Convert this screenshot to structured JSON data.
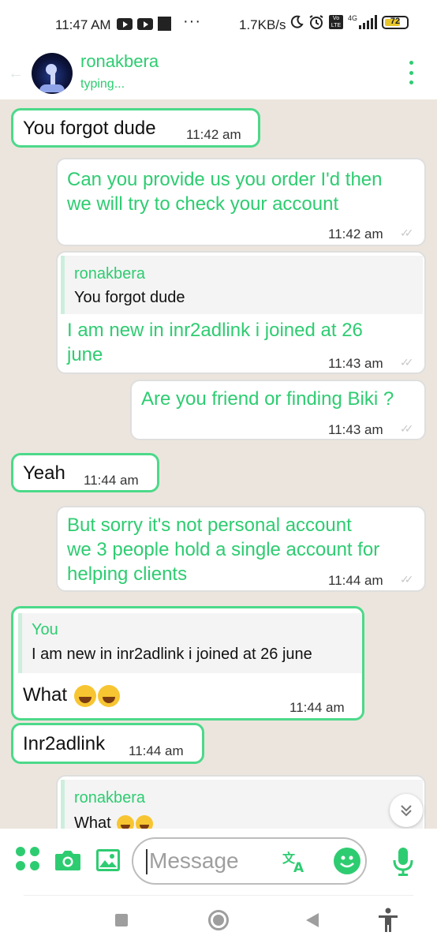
{
  "status_bar": {
    "time": "11:47 AM",
    "dots": "···",
    "network_speed": "1.7KB/s",
    "network_type": "4G",
    "volte": "Vo LTE",
    "battery": "72",
    "battery_level": 0.72,
    "icons": [
      "youtube-icon",
      "youtube-icon",
      "app-icon",
      "moon-icon",
      "alarm-icon",
      "volte-icon",
      "signal-icon",
      "battery-icon"
    ]
  },
  "header": {
    "contact_name": "ronakbera",
    "contact_status": "typing...",
    "icons": [
      "back-arrow-icon",
      "avatar",
      "more-vert-icon"
    ]
  },
  "messages": [
    {
      "direction": "in",
      "text": "You forgot dude",
      "time": "11:42 am"
    },
    {
      "direction": "out",
      "text_lines": [
        "Can you provide us you order I'd then",
        "we will try to check your account"
      ],
      "time": "11:42 am"
    },
    {
      "direction": "out",
      "quote": {
        "name": "ronakbera",
        "text": "You forgot dude"
      },
      "text_lines": [
        "I am new in inr2adlink i joined at 26",
        "june"
      ],
      "time": "11:43 am"
    },
    {
      "direction": "out",
      "text": "Are you friend or finding Biki ?",
      "time": "11:43 am"
    },
    {
      "direction": "in",
      "text": "Yeah",
      "time": "11:44 am"
    },
    {
      "direction": "out",
      "text_lines": [
        "But sorry it's not personal account",
        "we 3 people hold a single account for",
        "helping clients"
      ],
      "time": "11:44 am"
    },
    {
      "direction": "in",
      "quote": {
        "name": "You",
        "text": "I am new in inr2adlink i joined at 26 june"
      },
      "text": "What",
      "emojis": [
        "rofl-emoji",
        "rofl-emoji"
      ],
      "time": "11:44 am"
    },
    {
      "direction": "in",
      "text": "Inr2adlink",
      "time": "11:44 am"
    },
    {
      "direction": "out",
      "quote": {
        "name": "ronakbera",
        "text": "What"
      },
      "emojis": [
        "rofl-emoji",
        "rofl-emoji"
      ]
    }
  ],
  "input_bar": {
    "placeholder": "Message",
    "icons": [
      "apps-icon",
      "camera-icon",
      "gallery-icon",
      "translate-icon",
      "emoji-icon",
      "mic-icon"
    ]
  },
  "nav_bar": {
    "icons": [
      "recents-icon",
      "home-icon",
      "back-icon",
      "accessibility-icon"
    ]
  },
  "colors": {
    "accent": "#2ecc71",
    "chat_background": "#ece5dd",
    "incoming_border": "#4cd98a",
    "outgoing_border": "#dedede",
    "battery_fill": "#e8c62a"
  }
}
